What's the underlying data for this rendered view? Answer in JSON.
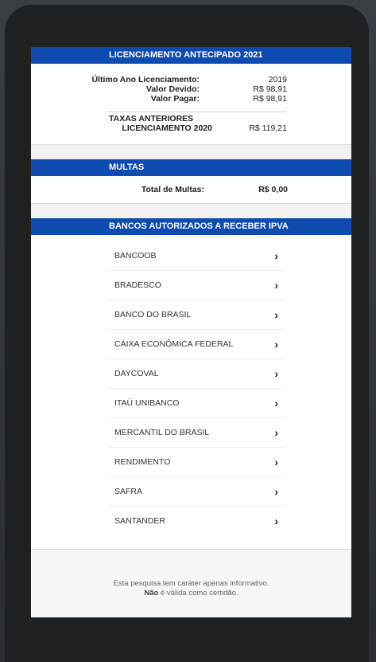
{
  "sections": {
    "licenciamento": {
      "title": "LICENCIAMENTO ANTECIPADO 2021",
      "rows": [
        {
          "label": "Último Ano Licenciamento:",
          "value": "2019"
        },
        {
          "label": "Valor Devido:",
          "value": "R$ 98,91"
        },
        {
          "label": "Valor Pagar:",
          "value": "R$ 98,91"
        }
      ],
      "taxas_title": "TAXAS ANTERIORES",
      "taxas_label": "LICENCIAMENTO 2020",
      "taxas_value": "R$ 119,21"
    },
    "multas": {
      "title": "MULTAS",
      "total_label": "Total de Multas:",
      "total_value": "R$ 0,00"
    },
    "bancos": {
      "title": "BANCOS AUTORIZADOS A RECEBER IPVA",
      "items": [
        "BANCOOB",
        "BRADESCO",
        "BANCO DO BRASIL",
        "CAIXA ECONÔMICA FEDERAL",
        "DAYCOVAL",
        "ITAÚ UNIBANCO",
        "MERCANTIL DO BRASIL",
        "RENDIMENTO",
        "SAFRA",
        "SANTANDER"
      ],
      "chevron": "›"
    }
  },
  "footer": {
    "line1": "Esta pesquisa tem caráter apenas informativo.",
    "line2_bold": "Não",
    "line2_rest": " é válida como certidão."
  },
  "colors": {
    "band": "#0d4bb0",
    "bezel": "#1e2124"
  }
}
